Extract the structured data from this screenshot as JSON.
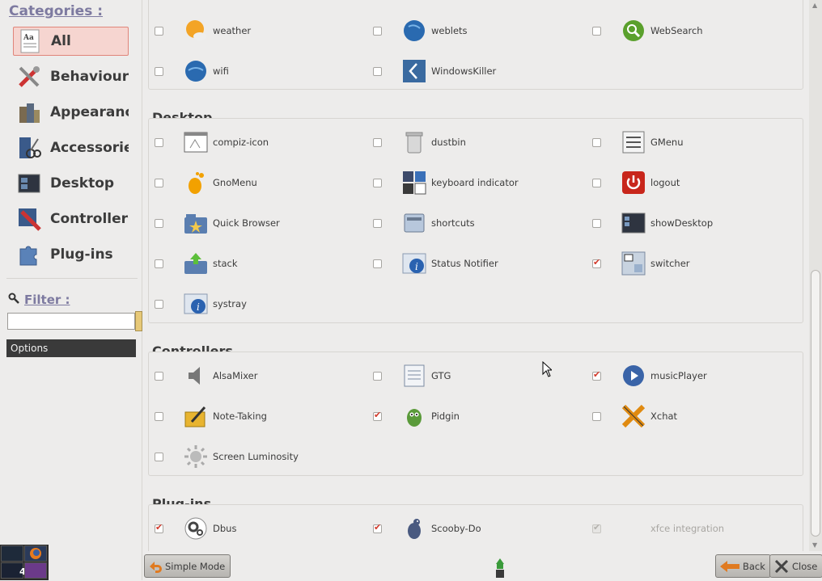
{
  "sidebar": {
    "categories_title": "Categories :",
    "items": [
      {
        "label": "All",
        "icon": "font-icon"
      },
      {
        "label": "Behaviour",
        "icon": "tools-icon"
      },
      {
        "label": "Appearance",
        "icon": "appearance-icon"
      },
      {
        "label": "Accessories",
        "icon": "scissors-icon"
      },
      {
        "label": "Desktop",
        "icon": "desktop-icon"
      },
      {
        "label": "Controllers",
        "icon": "controllers-icon"
      },
      {
        "label": "Plug-ins",
        "icon": "puzzle-icon"
      }
    ],
    "filter_title": "Filter :",
    "filter_value": "",
    "options_label": "Options"
  },
  "sections": {
    "top_row1": [
      {
        "label": "weather",
        "checked": false
      },
      {
        "label": "weblets",
        "checked": false
      },
      {
        "label": "WebSearch",
        "checked": false
      }
    ],
    "top_row2": [
      {
        "label": "wifi",
        "checked": false
      },
      {
        "label": "WindowsKiller",
        "checked": false
      }
    ],
    "desktop_title": "Desktop",
    "desktop_items": [
      {
        "label": "compiz-icon",
        "checked": false
      },
      {
        "label": "dustbin",
        "checked": false
      },
      {
        "label": "GMenu",
        "checked": false
      },
      {
        "label": "GnoMenu",
        "checked": false
      },
      {
        "label": "keyboard indicator",
        "checked": false
      },
      {
        "label": "logout",
        "checked": false
      },
      {
        "label": "Quick Browser",
        "checked": false
      },
      {
        "label": "shortcuts",
        "checked": false
      },
      {
        "label": "showDesktop",
        "checked": false
      },
      {
        "label": "stack",
        "checked": false
      },
      {
        "label": "Status Notifier",
        "checked": false
      },
      {
        "label": "switcher",
        "checked": true
      },
      {
        "label": "systray",
        "checked": false
      }
    ],
    "controllers_title": "Controllers",
    "controllers_items": [
      {
        "label": "AlsaMixer",
        "checked": false
      },
      {
        "label": "GTG",
        "checked": false
      },
      {
        "label": "musicPlayer",
        "checked": true
      },
      {
        "label": "Note-Taking",
        "checked": false
      },
      {
        "label": "Pidgin",
        "checked": true
      },
      {
        "label": "Xchat",
        "checked": false
      },
      {
        "label": "Screen Luminosity",
        "checked": false
      }
    ],
    "plugins_title": "Plug-ins",
    "plugins_items": [
      {
        "label": "Dbus",
        "checked": true
      },
      {
        "label": "Scooby-Do",
        "checked": true
      },
      {
        "label": "xfce integration",
        "checked": true,
        "disabled": true
      }
    ]
  },
  "bottom": {
    "simple_mode": "Simple Mode",
    "back": "Back",
    "close": "Close"
  },
  "taskbar": {
    "workspace_number": "4"
  },
  "colors": {
    "accent_red": "#d33a2c",
    "selection": "#f6d5d0",
    "options_bar": "#3a3a3a"
  }
}
